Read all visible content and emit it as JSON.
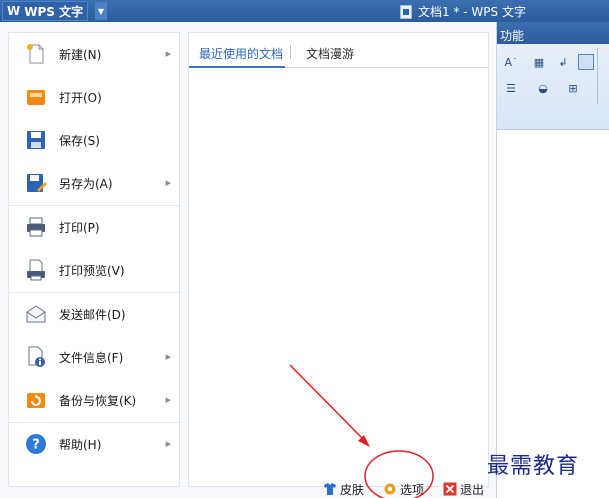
{
  "titlebar": {
    "logo": "W",
    "app_name": "WPS 文字",
    "document_title": "文档1 * - WPS 文字"
  },
  "ribbon": {
    "tab_label": "功能"
  },
  "menu": {
    "items": [
      {
        "label": "新建(N)",
        "has_submenu": true
      },
      {
        "label": "打开(O)",
        "has_submenu": false
      },
      {
        "label": "保存(S)",
        "has_submenu": false
      },
      {
        "label": "另存为(A)",
        "has_submenu": true
      },
      {
        "label": "打印(P)",
        "has_submenu": false
      },
      {
        "label": "打印预览(V)",
        "has_submenu": false
      },
      {
        "label": "发送邮件(D)",
        "has_submenu": false
      },
      {
        "label": "文件信息(F)",
        "has_submenu": true
      },
      {
        "label": "备份与恢复(K)",
        "has_submenu": true
      },
      {
        "label": "帮助(H)",
        "has_submenu": true
      }
    ]
  },
  "recent_panel": {
    "tabs": [
      {
        "label": "最近使用的文档",
        "active": true
      },
      {
        "label": "文档漫游",
        "active": false
      }
    ]
  },
  "footer": {
    "skin_label": "皮肤",
    "options_label": "选项",
    "exit_label": "退出"
  },
  "watermark": "最需教育",
  "colors": {
    "titlebar": "#2b5c9c",
    "accent": "#2a66c0",
    "annotation": "#e02020"
  }
}
